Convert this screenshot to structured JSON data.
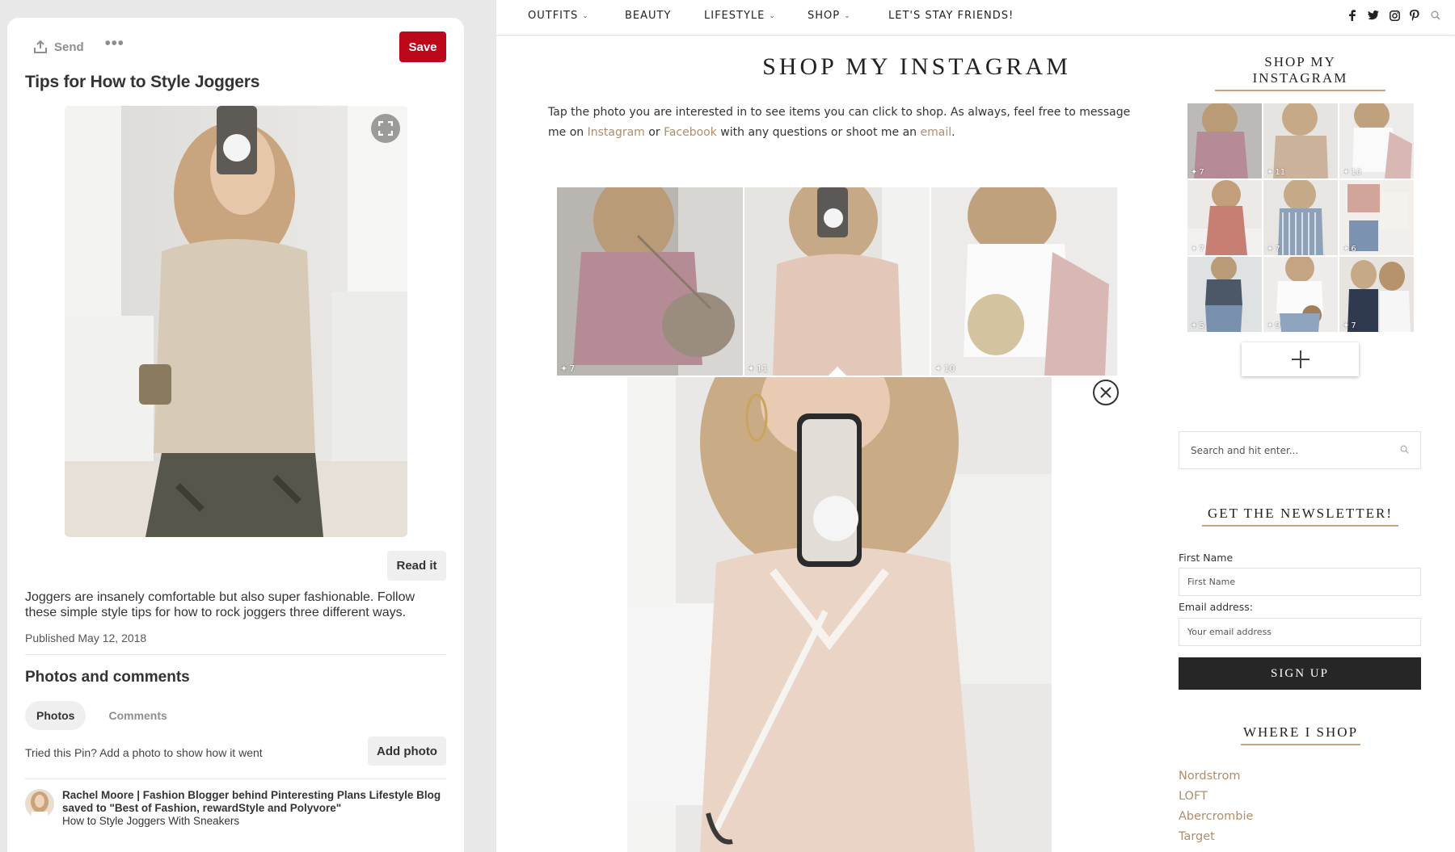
{
  "pin": {
    "send_label": "Send",
    "more_label": "•••",
    "save_label": "Save",
    "title": "Tips for How to Style Joggers",
    "read_label": "Read it",
    "description": "Joggers are insanely comfortable but also super fashionable. Follow these simple style tips for how to rock joggers three different ways.",
    "published": "Published May 12, 2018",
    "photos_heading": "Photos and comments",
    "tabs": [
      {
        "label": "Photos"
      },
      {
        "label": "Comments"
      }
    ],
    "tried_text": "Tried this Pin? Add a photo to show how it went",
    "add_photo_label": "Add photo",
    "saver": {
      "name": "Rachel Moore | Fashion Blogger behind Pinteresting Plans Lifestyle Blog",
      "saved_to": "saved to \"Best of Fashion, rewardStyle and Polyvore\"",
      "board_title": "How to Style Joggers With Sneakers"
    }
  },
  "blog": {
    "nav": [
      {
        "label": "OUTFITS",
        "has_dropdown": true
      },
      {
        "label": "BEAUTY",
        "has_dropdown": false
      },
      {
        "label": "LIFESTYLE",
        "has_dropdown": true
      },
      {
        "label": "SHOP",
        "has_dropdown": true
      },
      {
        "label": "LET'S STAY FRIENDS!",
        "has_dropdown": false
      }
    ],
    "social_icons": [
      "facebook-icon",
      "twitter-icon",
      "instagram-icon",
      "pinterest-icon",
      "search-icon"
    ],
    "page_title": "SHOP MY INSTAGRAM",
    "intro": {
      "part1": "Tap the photo you are interested in to see items you can click to shop.  As always, feel free to message me on ",
      "instagram": "Instagram",
      "or": " or ",
      "facebook": "Facebook",
      "part2": " with any questions or shoot me an ",
      "email": "email",
      "end": "."
    },
    "main_grid": [
      {
        "count": "7"
      },
      {
        "count": "11"
      },
      {
        "count": "10"
      }
    ],
    "sidebar": {
      "instagram_heading": "SHOP MY INSTAGRAM",
      "insta_grid": [
        {
          "count": "7"
        },
        {
          "count": "11"
        },
        {
          "count": "10"
        },
        {
          "count": "7"
        },
        {
          "count": "7"
        },
        {
          "count": "6"
        },
        {
          "count": "5"
        },
        {
          "count": "9"
        },
        {
          "count": "7"
        }
      ],
      "search_placeholder": "Search and hit enter...",
      "newsletter_heading": "GET THE NEWSLETTER!",
      "first_name_label": "First Name",
      "first_name_placeholder": "First Name",
      "email_label": "Email address:",
      "email_placeholder": "Your email address",
      "signup_label": "SIGN UP",
      "where_heading": "WHERE I SHOP",
      "shops": [
        "Nordstrom",
        "LOFT",
        "Abercrombie",
        "Target"
      ]
    }
  },
  "colors": {
    "pinterest_red": "#bd081c",
    "accent_gold": "#b08d6a",
    "dark_button": "#262626"
  }
}
